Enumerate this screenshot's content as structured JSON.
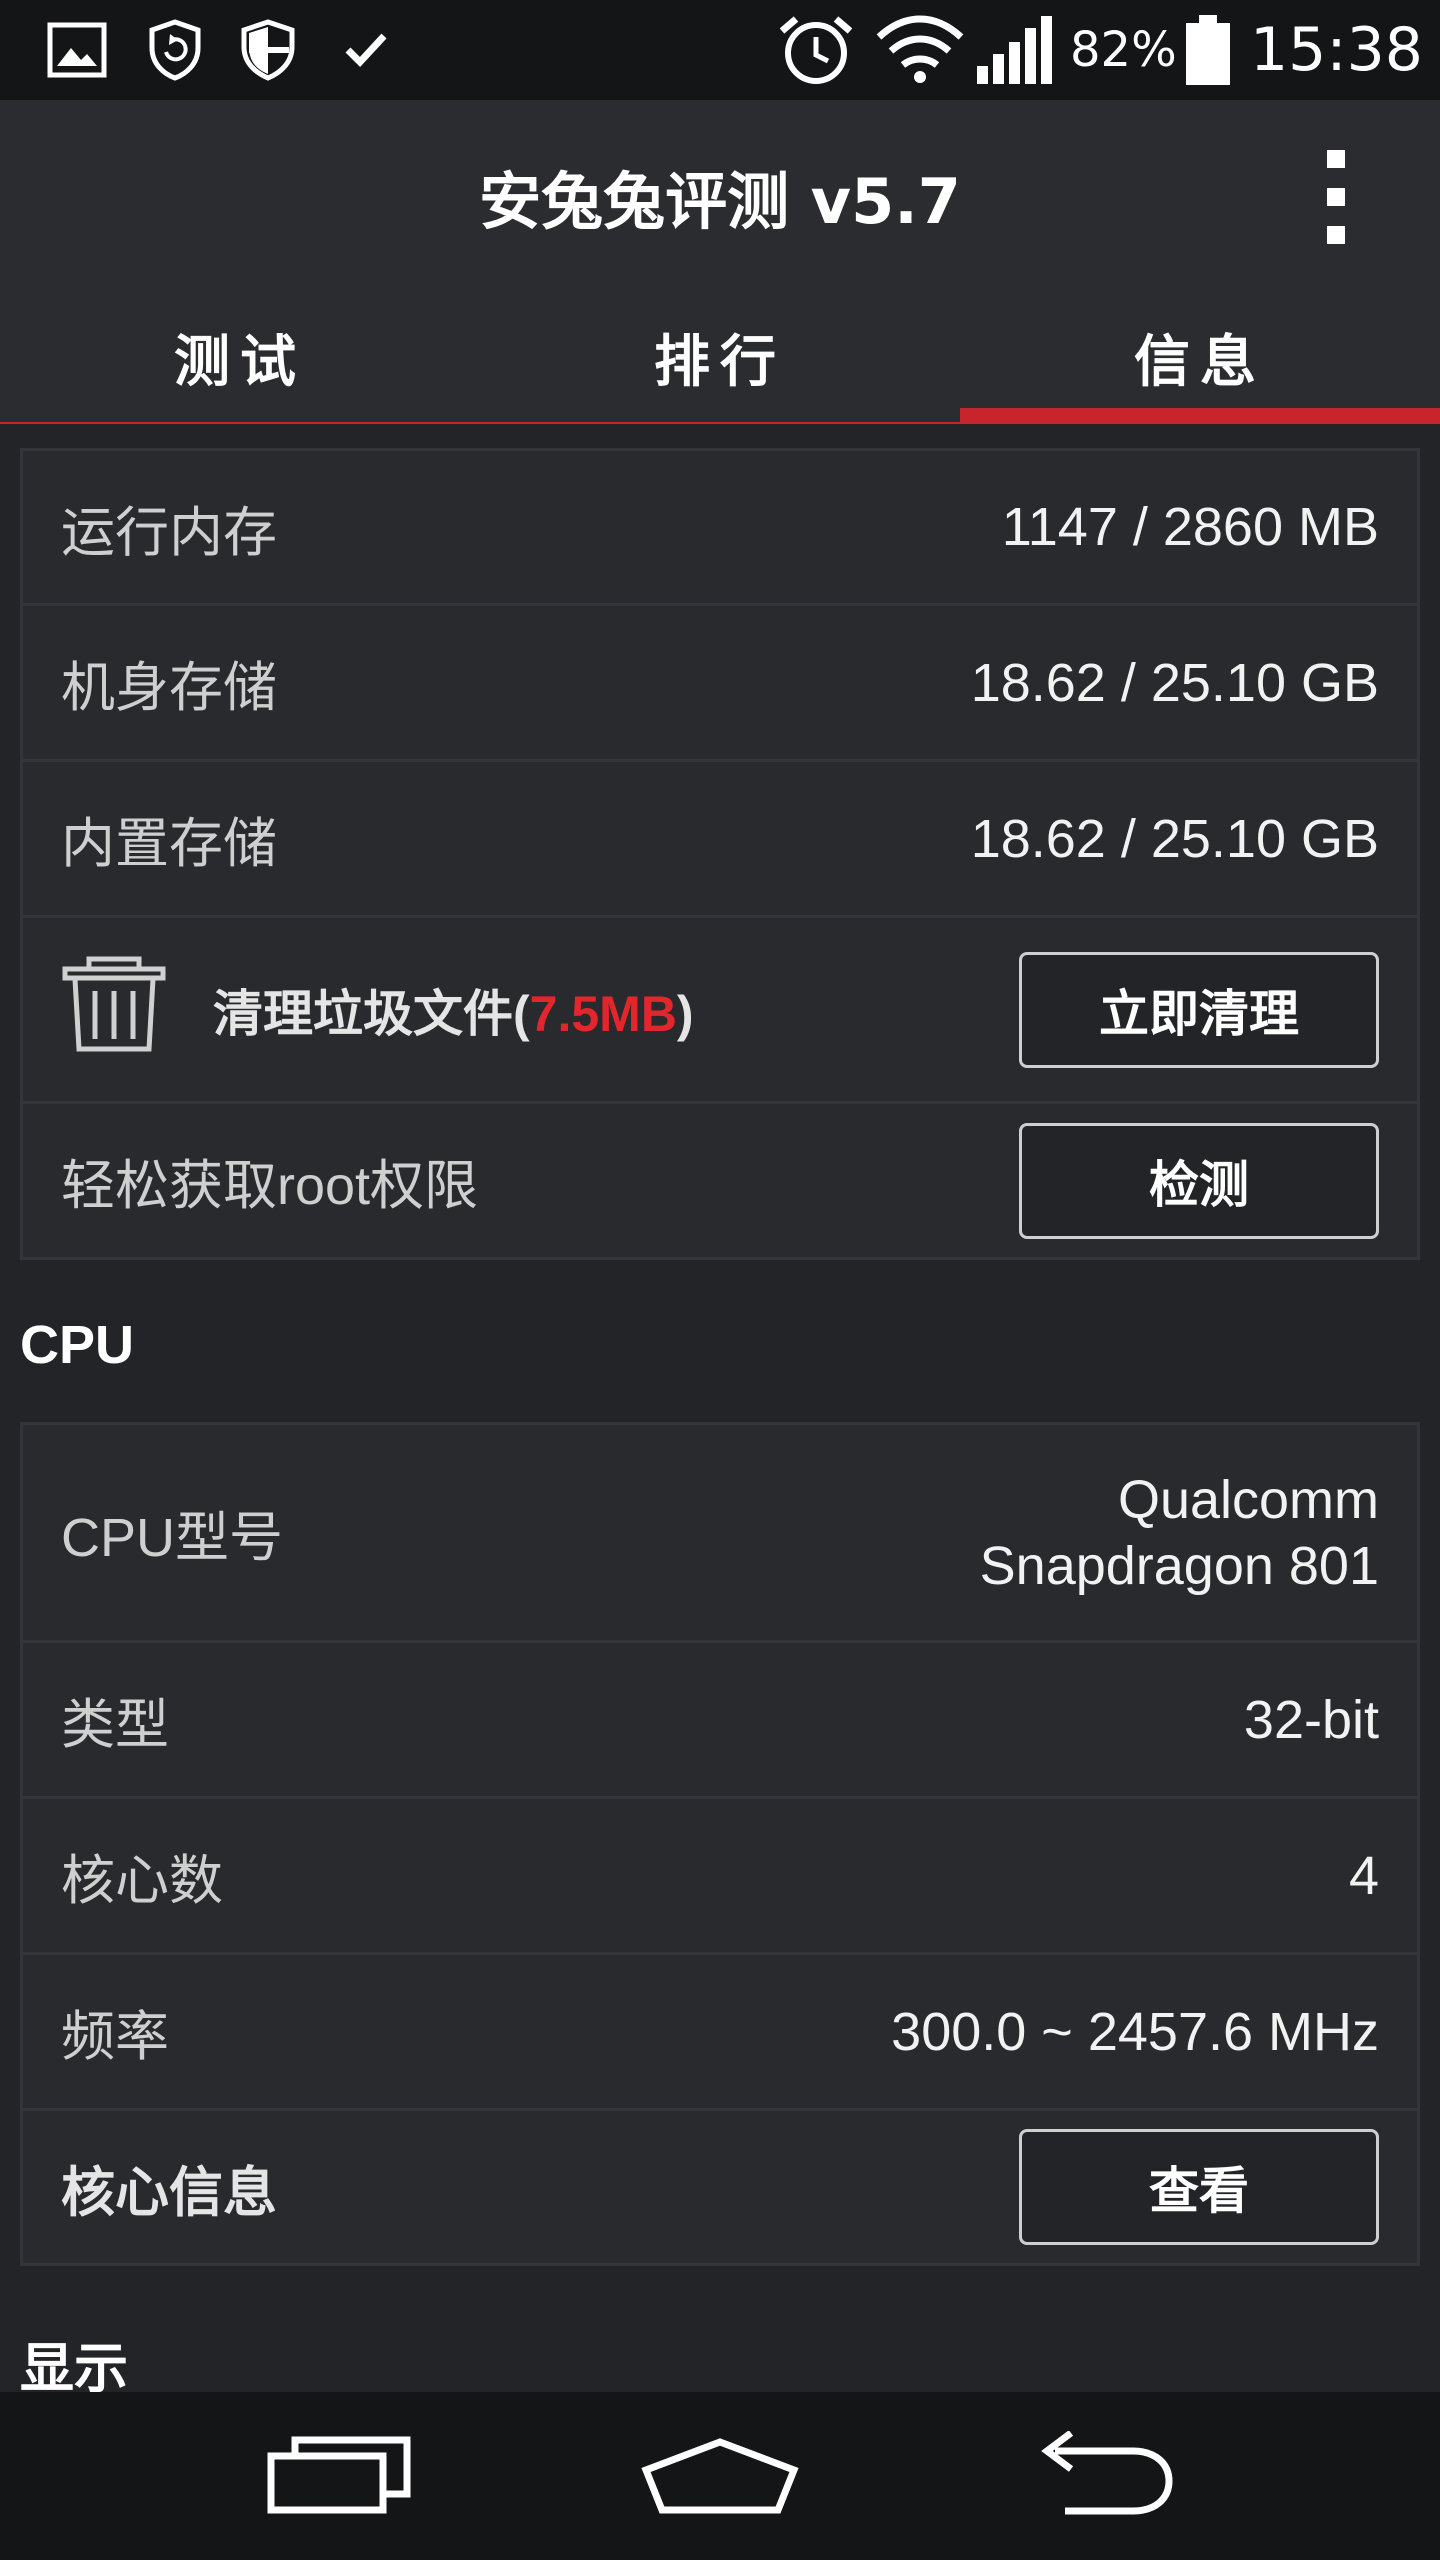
{
  "status_bar": {
    "icons": [
      "image-icon",
      "shield-refresh-icon",
      "shield-icon",
      "check-icon",
      "alarm-icon",
      "wifi-icon",
      "signal-icon",
      "battery-icon"
    ],
    "battery_percent": "82%",
    "time": "15:38"
  },
  "app_bar": {
    "title": "安兔兔评测 v5.7",
    "menu_icon": "more-vertical-icon"
  },
  "tabs": [
    {
      "label": "测试",
      "active": false
    },
    {
      "label": "排行",
      "active": false
    },
    {
      "label": "信息",
      "active": true
    }
  ],
  "storage_card": {
    "ram_label": "运行内存",
    "ram_value": "1147 / 2860 MB",
    "phone_storage_label": "机身存储",
    "phone_storage_value": "18.62 / 25.10 GB",
    "internal_storage_label": "内置存储",
    "internal_storage_value": "18.62 / 25.10 GB",
    "clean_label_prefix": "清理垃圾文件(",
    "clean_size": "7.5MB",
    "clean_label_suffix": ")",
    "clean_button": "立即清理",
    "root_label": "轻松获取root权限",
    "root_button": "检测"
  },
  "cpu_section": {
    "title": "CPU",
    "model_label": "CPU型号",
    "model_value_line1": "Qualcomm",
    "model_value_line2": "Snapdragon 801",
    "type_label": "类型",
    "type_value": "32-bit",
    "cores_label": "核心数",
    "cores_value": "4",
    "freq_label": "频率",
    "freq_value": "300.0 ~ 2457.6 MHz",
    "core_info_label": "核心信息",
    "core_info_button": "查看"
  },
  "display_section": {
    "title": "显示"
  },
  "nav_bar": {
    "buttons": [
      "recent-apps-icon",
      "home-icon",
      "back-icon"
    ]
  },
  "colors": {
    "accent": "#c7252c",
    "highlight_red": "#e3262b",
    "background": "#232427",
    "card": "#292a2e"
  }
}
